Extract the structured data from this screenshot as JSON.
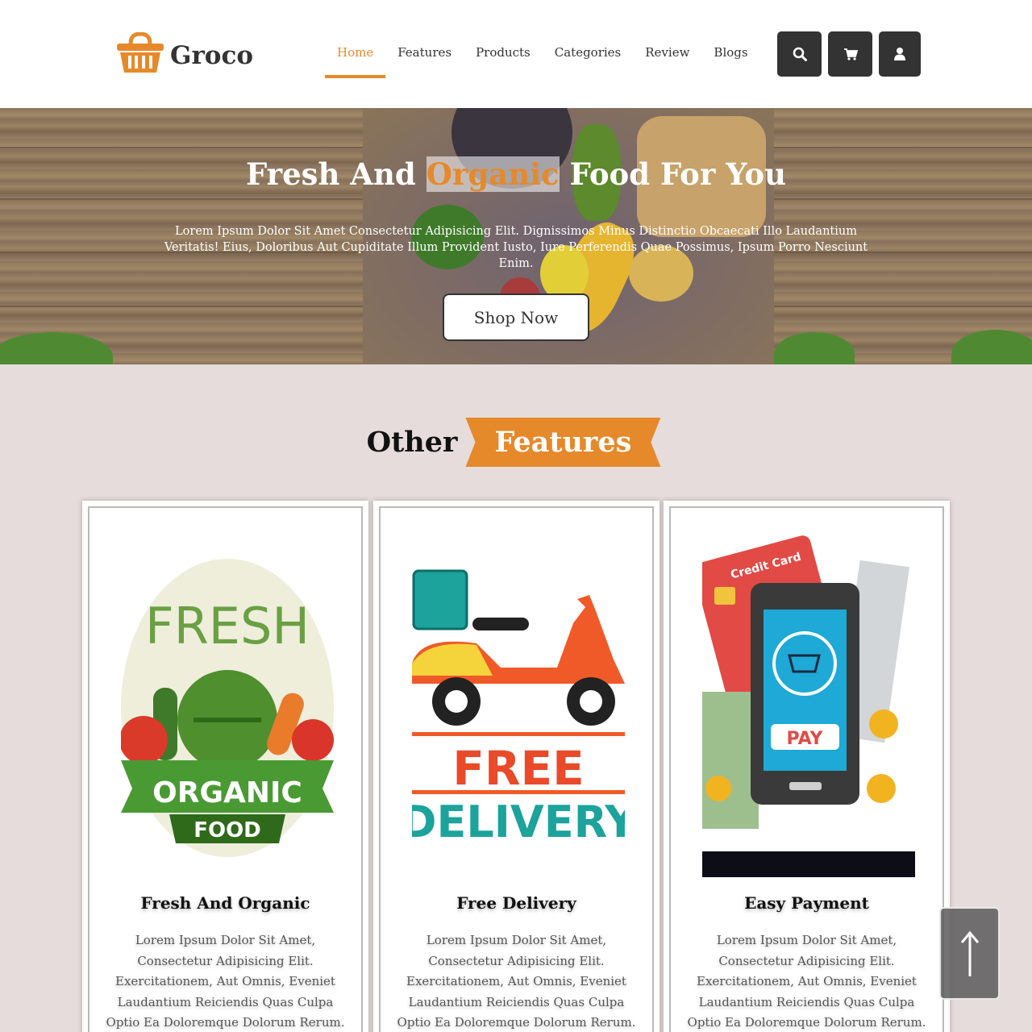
{
  "header": {
    "brand": "Groco",
    "nav": [
      {
        "label": "Home",
        "active": true
      },
      {
        "label": "Features",
        "active": false
      },
      {
        "label": "Products",
        "active": false
      },
      {
        "label": "Categories",
        "active": false
      },
      {
        "label": "Review",
        "active": false
      },
      {
        "label": "Blogs",
        "active": false
      }
    ],
    "icons": [
      "search-icon",
      "cart-icon",
      "user-icon"
    ]
  },
  "hero": {
    "title_before": "Fresh And ",
    "title_highlight": "Organic",
    "title_after": " Food For You",
    "description": "Lorem Ipsum Dolor Sit Amet Consectetur Adipisicing Elit. Dignissimos Minus Distinctio Obcaecati Illo Laudantium Veritatis! Eius, Doloribus Aut Cupiditate Illum Provident Iusto, Iure Perferendis Quae Possimus, Ipsum Porro Nesciunt Enim.",
    "button": "Shop Now"
  },
  "features": {
    "heading_plain": "Other",
    "heading_badge": "Features",
    "cards": [
      {
        "title": "Fresh And Organic",
        "description": "Lorem Ipsum Dolor Sit Amet, Consectetur Adipisicing Elit. Exercitationem, Aut Omnis, Eveniet Laudantium Reiciendis Quas Culpa Optio Ea Doloremque Dolorum Rerum. Ullam Velit Error, Et",
        "image_text": [
          "FRESH",
          "ORGANIC",
          "FOOD"
        ]
      },
      {
        "title": "Free Delivery",
        "description": "Lorem Ipsum Dolor Sit Amet, Consectetur Adipisicing Elit. Exercitationem, Aut Omnis, Eveniet Laudantium Reiciendis Quas Culpa Optio Ea Doloremque Dolorum Rerum. Ullam Velit Error, Et",
        "image_text": [
          "FREE",
          "DELIVERY"
        ]
      },
      {
        "title": "Easy Payment",
        "description": "Lorem Ipsum Dolor Sit Amet, Consectetur Adipisicing Elit. Exercitationem, Aut Omnis, Eveniet Laudantium Reiciendis Quas Culpa Optio Ea Doloremque Dolorum Rerum. Ullam Velit Error, Et",
        "image_text": [
          "Credit Card",
          "PAY"
        ]
      }
    ]
  },
  "scroll_top_icon": "arrow-up-icon",
  "colors": {
    "accent": "#e6892a",
    "dark": "#333333",
    "section_bg": "#e6dcdb"
  }
}
